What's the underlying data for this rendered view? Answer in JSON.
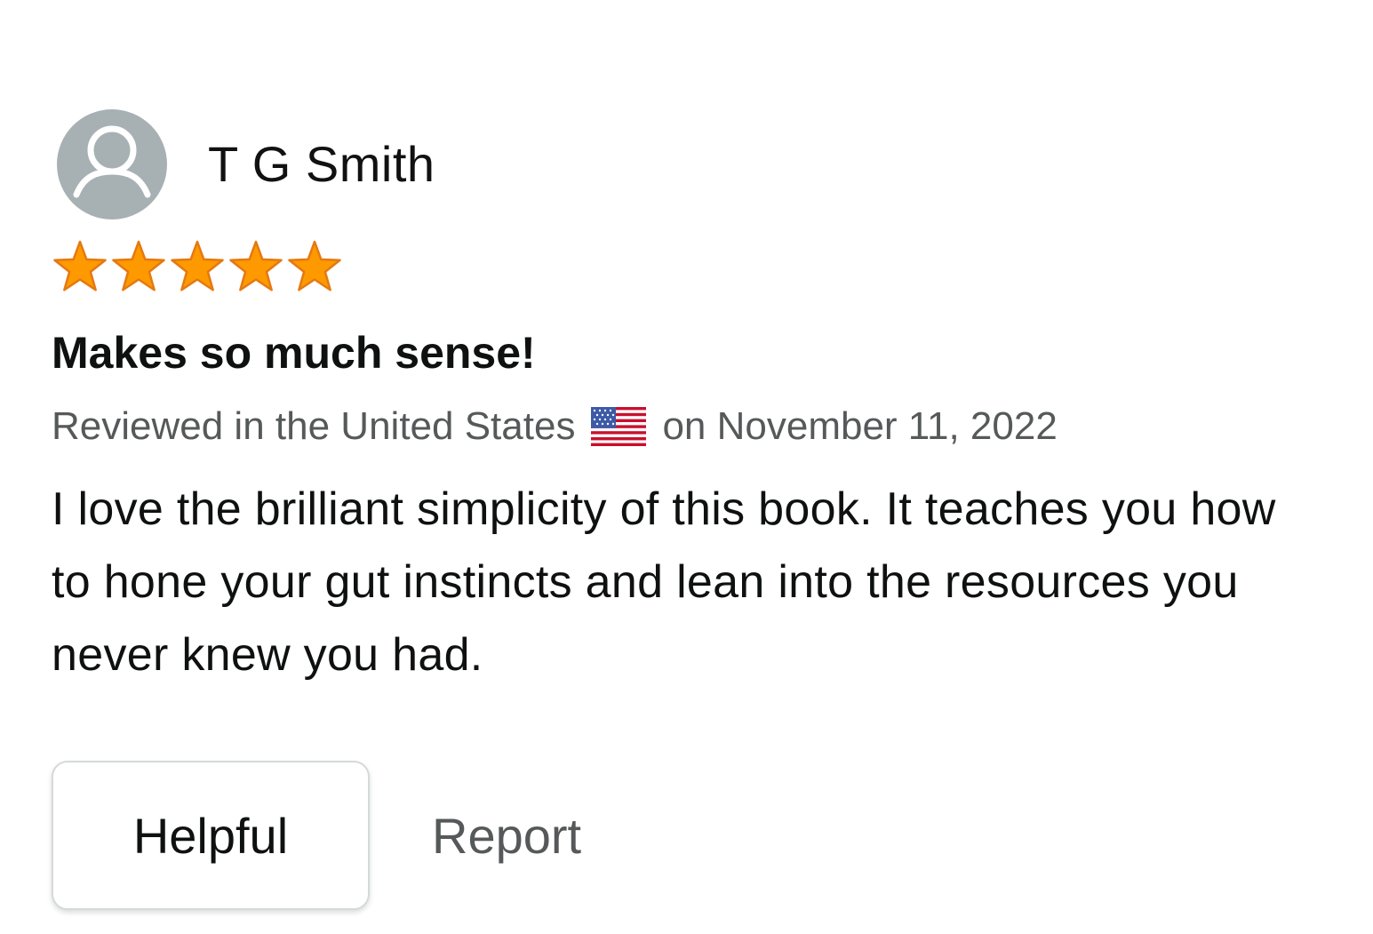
{
  "review": {
    "profile_name": "T G Smith",
    "avatar_icon": "user-silhouette-icon",
    "rating": 5,
    "rating_max": 5,
    "star_color": "#ff9900",
    "star_stroke": "#e47911",
    "title": "Makes so much sense!",
    "meta_prefix": "Reviewed in the United States",
    "flag_icon": "us-flag-icon",
    "meta_date": "on November 11, 2022",
    "body": "I love the brilliant simplicity of this book. It teaches you how to hone your gut instincts and lean into the resources you never knew you had."
  },
  "actions": {
    "helpful_label": "Helpful",
    "report_label": "Report"
  }
}
